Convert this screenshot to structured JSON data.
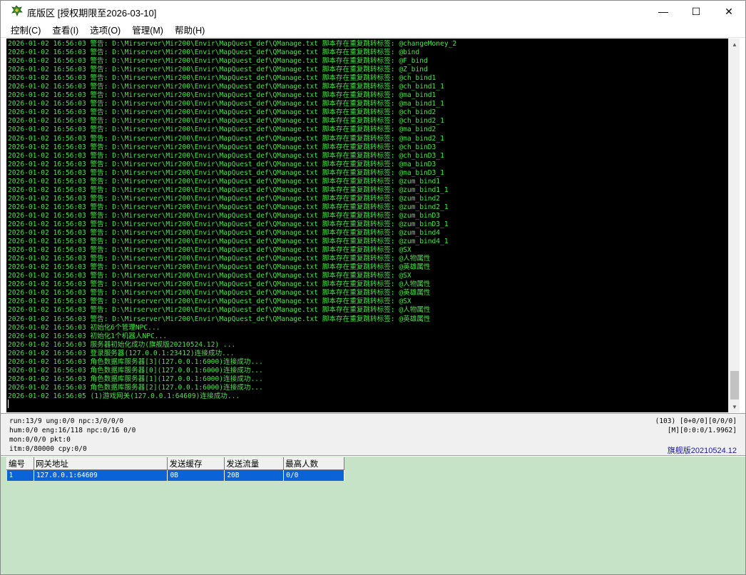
{
  "window": {
    "title": "底版区 [授权期限至2026-03-10]",
    "minimize": "—",
    "maximize": "☐",
    "close": "✕"
  },
  "menu": [
    "控制(C)",
    "查看(I)",
    "选项(O)",
    "管理(M)",
    "帮助(H)"
  ],
  "log": [
    "2026-01-02 16:56:03 警告: D:\\Mirserver\\Mir200\\Envir\\MapQuest_def\\QManage.txt 脚本存在重复跳转标签: @changeMoney_2",
    "2026-01-02 16:56:03 警告: D:\\Mirserver\\Mir200\\Envir\\MapQuest_def\\QManage.txt 脚本存在重复跳转标签: @bind",
    "2026-01-02 16:56:03 警告: D:\\Mirserver\\Mir200\\Envir\\MapQuest_def\\QManage.txt 脚本存在重复跳转标签: @F_bind",
    "2026-01-02 16:56:03 警告: D:\\Mirserver\\Mir200\\Envir\\MapQuest_def\\QManage.txt 脚本存在重复跳转标签: @Z_bind",
    "2026-01-02 16:56:03 警告: D:\\Mirserver\\Mir200\\Envir\\MapQuest_def\\QManage.txt 脚本存在重复跳转标签: @ch_bind1",
    "2026-01-02 16:56:03 警告: D:\\Mirserver\\Mir200\\Envir\\MapQuest_def\\QManage.txt 脚本存在重复跳转标签: @ch_bind1_1",
    "2026-01-02 16:56:03 警告: D:\\Mirserver\\Mir200\\Envir\\MapQuest_def\\QManage.txt 脚本存在重复跳转标签: @ma_bind1",
    "2026-01-02 16:56:03 警告: D:\\Mirserver\\Mir200\\Envir\\MapQuest_def\\QManage.txt 脚本存在重复跳转标签: @ma_bind1_1",
    "2026-01-02 16:56:03 警告: D:\\Mirserver\\Mir200\\Envir\\MapQuest_def\\QManage.txt 脚本存在重复跳转标签: @ch_bind2",
    "2026-01-02 16:56:03 警告: D:\\Mirserver\\Mir200\\Envir\\MapQuest_def\\QManage.txt 脚本存在重复跳转标签: @ch_bind2_1",
    "2026-01-02 16:56:03 警告: D:\\Mirserver\\Mir200\\Envir\\MapQuest_def\\QManage.txt 脚本存在重复跳转标签: @ma_bind2",
    "2026-01-02 16:56:03 警告: D:\\Mirserver\\Mir200\\Envir\\MapQuest_def\\QManage.txt 脚本存在重复跳转标签: @ma_bind2_1",
    "2026-01-02 16:56:03 警告: D:\\Mirserver\\Mir200\\Envir\\MapQuest_def\\QManage.txt 脚本存在重复跳转标签: @ch_binD3",
    "2026-01-02 16:56:03 警告: D:\\Mirserver\\Mir200\\Envir\\MapQuest_def\\QManage.txt 脚本存在重复跳转标签: @ch_binD3_1",
    "2026-01-02 16:56:03 警告: D:\\Mirserver\\Mir200\\Envir\\MapQuest_def\\QManage.txt 脚本存在重复跳转标签: @ma_binD3",
    "2026-01-02 16:56:03 警告: D:\\Mirserver\\Mir200\\Envir\\MapQuest_def\\QManage.txt 脚本存在重复跳转标签: @ma_binD3_1",
    "2026-01-02 16:56:03 警告: D:\\Mirserver\\Mir200\\Envir\\MapQuest_def\\QManage.txt 脚本存在重复跳转标签: @zum_bind1",
    "2026-01-02 16:56:03 警告: D:\\Mirserver\\Mir200\\Envir\\MapQuest_def\\QManage.txt 脚本存在重复跳转标签: @zum_bind1_1",
    "2026-01-02 16:56:03 警告: D:\\Mirserver\\Mir200\\Envir\\MapQuest_def\\QManage.txt 脚本存在重复跳转标签: @zum_bind2",
    "2026-01-02 16:56:03 警告: D:\\Mirserver\\Mir200\\Envir\\MapQuest_def\\QManage.txt 脚本存在重复跳转标签: @zum_bind2_1",
    "2026-01-02 16:56:03 警告: D:\\Mirserver\\Mir200\\Envir\\MapQuest_def\\QManage.txt 脚本存在重复跳转标签: @zum_binD3",
    "2026-01-02 16:56:03 警告: D:\\Mirserver\\Mir200\\Envir\\MapQuest_def\\QManage.txt 脚本存在重复跳转标签: @zum_binD3_1",
    "2026-01-02 16:56:03 警告: D:\\Mirserver\\Mir200\\Envir\\MapQuest_def\\QManage.txt 脚本存在重复跳转标签: @zum_bind4",
    "2026-01-02 16:56:03 警告: D:\\Mirserver\\Mir200\\Envir\\MapQuest_def\\QManage.txt 脚本存在重复跳转标签: @zum_bind4_1",
    "2026-01-02 16:56:03 警告: D:\\Mirserver\\Mir200\\Envir\\MapQuest_def\\QManage.txt 脚本存在重复跳转标签: @SX",
    "2026-01-02 16:56:03 警告: D:\\Mirserver\\Mir200\\Envir\\MapQuest_def\\QManage.txt 脚本存在重复跳转标签: @人物属性",
    "2026-01-02 16:56:03 警告: D:\\Mirserver\\Mir200\\Envir\\MapQuest_def\\QManage.txt 脚本存在重复跳转标签: @英雄属性",
    "2026-01-02 16:56:03 警告: D:\\Mirserver\\Mir200\\Envir\\MapQuest_def\\QManage.txt 脚本存在重复跳转标签: @SX",
    "2026-01-02 16:56:03 警告: D:\\Mirserver\\Mir200\\Envir\\MapQuest_def\\QManage.txt 脚本存在重复跳转标签: @人物属性",
    "2026-01-02 16:56:03 警告: D:\\Mirserver\\Mir200\\Envir\\MapQuest_def\\QManage.txt 脚本存在重复跳转标签: @英雄属性",
    "2026-01-02 16:56:03 警告: D:\\Mirserver\\Mir200\\Envir\\MapQuest_def\\QManage.txt 脚本存在重复跳转标签: @SX",
    "2026-01-02 16:56:03 警告: D:\\Mirserver\\Mir200\\Envir\\MapQuest_def\\QManage.txt 脚本存在重复跳转标签: @人物属性",
    "2026-01-02 16:56:03 警告: D:\\Mirserver\\Mir200\\Envir\\MapQuest_def\\QManage.txt 脚本存在重复跳转标签: @英雄属性",
    "2026-01-02 16:56:03 初始化6个管理NPC...",
    "2026-01-02 16:56:03 初始化1个机器人NPC...",
    "2026-01-02 16:56:03 服务器初始化成功(旗舰版20210524.12) ...",
    "2026-01-02 16:56:03 登录服务器(127.0.0.1:23412)连接成功...",
    "2026-01-02 16:56:03 角色数据库服务器[3](127.0.0.1:6000)连接成功...",
    "2026-01-02 16:56:03 角色数据库服务器[0](127.0.0.1:6000)连接成功...",
    "2026-01-02 16:56:03 角色数据库服务器[1](127.0.0.1:6000)连接成功...",
    "2026-01-02 16:56:03 角色数据库服务器[2](127.0.0.1:6000)连接成功...",
    "2026-01-02 16:56:05 (1)游戏网关(127.0.0.1:64609)连接成功..."
  ],
  "status": {
    "run": "run:13/9 ung:0/0 npc:3/0/0/0",
    "hum": "hum:0/0 eng:16/118 npc:0/16 0/0",
    "mon": "mon:0/0/0 pkt:0",
    "itm": "itm:0/80000 cpy:0/0",
    "right1": "(103) [0+0/0][0/0/0]",
    "right2": "[M][0:0:0/1.9962]",
    "version": "旗舰版20210524.12"
  },
  "gateway_table": {
    "headers": [
      "编号",
      "网关地址",
      "发送缓存",
      "发送流量",
      "最高人数"
    ],
    "rows": [
      [
        "1",
        "127.0.0.1:64609",
        "0B",
        "20B",
        "0/0"
      ]
    ]
  },
  "colors": {
    "log_text": "#49e549",
    "log_bg": "#000000",
    "bottom_bg": "#c7e3c7",
    "selection": "#0a64d6"
  }
}
